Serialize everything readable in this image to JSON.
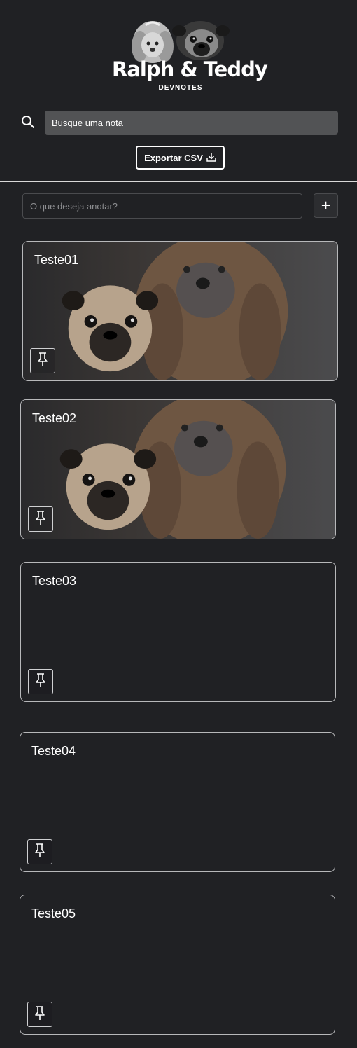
{
  "app": {
    "logo_title": "Ralph & Teddy",
    "logo_subtitle": "DEVNOTES"
  },
  "search": {
    "placeholder": "Busque uma nota",
    "icon": "search-icon"
  },
  "toolbar": {
    "export_label": "Exportar CSV",
    "export_icon": "download-icon"
  },
  "composer": {
    "placeholder": "O que deseja anotar?",
    "add_label": "+"
  },
  "notes": [
    {
      "title": "Teste01",
      "has_image": true,
      "pin_icon": "pin-icon"
    },
    {
      "title": "Teste02",
      "has_image": true,
      "pin_icon": "pin-icon"
    },
    {
      "title": "Teste03",
      "has_image": false,
      "pin_icon": "pin-icon"
    },
    {
      "title": "Teste04",
      "has_image": false,
      "pin_icon": "pin-icon"
    },
    {
      "title": "Teste05",
      "has_image": false,
      "pin_icon": "pin-icon"
    }
  ],
  "colors": {
    "background": "#202124",
    "search_bg": "#525355",
    "card_border": "#b7b8ba",
    "text": "#ffffff"
  }
}
